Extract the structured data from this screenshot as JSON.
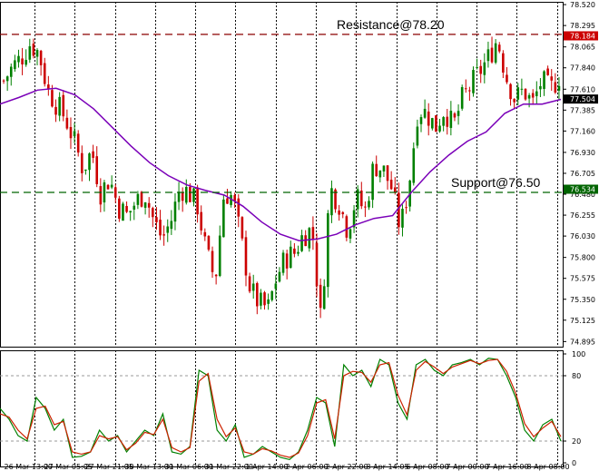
{
  "chart_data": [
    {
      "type": "candlestick",
      "panel": "price",
      "title": "",
      "ylim": [
        74.84,
        78.55
      ],
      "y_ticks": [
        "78.520",
        "78.295",
        "78.065",
        "77.840",
        "77.610",
        "77.385",
        "77.160",
        "76.930",
        "76.705",
        "76.480",
        "76.255",
        "76.030",
        "75.800",
        "75.575",
        "75.350",
        "75.125",
        "74.895"
      ],
      "x_ticks": [
        "26 Mar 13:00",
        "27 Mar 05:05",
        "27 Mar 21:05",
        "30 Mar 13:00",
        "31 Mar 06:00",
        "31 Mar 22:00",
        "1 Apr 14:00",
        "2 Apr 06:00",
        "2 Apr 22:00",
        "3 Apr 14:05",
        "6 Apr 08:00",
        "7 Apr 00:00",
        "7 Apr 16:00",
        "8 Apr 08:00"
      ],
      "grid": true,
      "bull_color": "#008000",
      "bear_color": "#cc0000",
      "close_path": [
        77.7,
        77.85,
        77.95,
        78.1,
        78.0,
        77.6,
        77.45,
        77.3,
        77.05,
        76.75,
        76.95,
        76.5,
        76.65,
        76.35,
        76.25,
        76.4,
        76.5,
        76.2,
        76.0,
        76.2,
        76.55,
        76.5,
        76.35,
        75.85,
        75.55,
        76.5,
        76.45,
        75.95,
        75.45,
        75.3,
        75.25,
        75.6,
        75.8,
        75.85,
        76.05,
        76.1,
        75.1,
        76.55,
        76.4,
        76.1,
        76.45,
        76.3,
        76.8,
        76.75,
        76.55,
        76.1,
        76.6,
        77.4,
        77.35,
        77.2,
        77.4,
        77.2,
        77.5,
        77.65,
        77.8,
        77.95,
        78.15,
        77.75,
        77.5,
        77.6,
        77.45,
        77.7,
        77.6,
        77.75
      ],
      "moving_average": {
        "color": "#7a00b8",
        "values": [
          77.45,
          77.52,
          77.6,
          77.62,
          77.55,
          77.4,
          77.2,
          77.0,
          76.82,
          76.68,
          76.58,
          76.52,
          76.47,
          76.35,
          76.18,
          76.05,
          75.98,
          76.0,
          76.05,
          76.15,
          76.22,
          76.25,
          76.5,
          76.72,
          76.9,
          77.05,
          77.15,
          77.35,
          77.45,
          77.45,
          77.5
        ]
      },
      "annotations": [
        {
          "text": "Resistance@78.20",
          "level": 78.2,
          "color": "#8b0000",
          "style": "dashed"
        },
        {
          "text": "Support@76.50",
          "level": 76.5,
          "color": "#006400",
          "style": "dashed"
        }
      ],
      "price_labels": [
        {
          "text": "78.184",
          "value": 78.184,
          "color": "#cc0000",
          "text_color": "#ffffff"
        },
        {
          "text": "77.504",
          "value": 77.504,
          "color": "#000000",
          "text_color": "#ffffff"
        },
        {
          "text": "76.534",
          "value": 76.534,
          "color": "#006400",
          "text_color": "#ffffff"
        }
      ]
    },
    {
      "type": "line",
      "panel": "stochastic",
      "ylim": [
        0,
        100
      ],
      "y_ticks": [
        "100",
        "80",
        "20",
        "0"
      ],
      "levels": [
        80,
        20
      ],
      "series": [
        {
          "color": "#008000",
          "values": [
            50,
            40,
            25,
            20,
            60,
            50,
            30,
            40,
            5,
            6,
            10,
            30,
            20,
            25,
            10,
            20,
            30,
            25,
            45,
            10,
            8,
            15,
            85,
            80,
            30,
            20,
            35,
            5,
            8,
            15,
            10,
            5,
            3,
            10,
            30,
            60,
            55,
            15,
            90,
            80,
            85,
            70,
            95,
            90,
            55,
            40,
            90,
            95,
            85,
            80,
            90,
            92,
            95,
            90,
            96,
            95,
            80,
            60,
            30,
            20,
            35,
            40,
            20
          ]
        },
        {
          "color": "#cc2200",
          "values": [
            45,
            42,
            30,
            22,
            50,
            52,
            35,
            38,
            10,
            8,
            10,
            25,
            22,
            24,
            12,
            18,
            28,
            26,
            40,
            14,
            10,
            14,
            75,
            82,
            40,
            24,
            32,
            10,
            8,
            13,
            11,
            7,
            5,
            9,
            25,
            55,
            58,
            22,
            80,
            84,
            83,
            74,
            90,
            92,
            62,
            44,
            85,
            93,
            88,
            82,
            88,
            91,
            94,
            91,
            94,
            95,
            84,
            64,
            36,
            24,
            32,
            38,
            24
          ]
        }
      ]
    }
  ]
}
